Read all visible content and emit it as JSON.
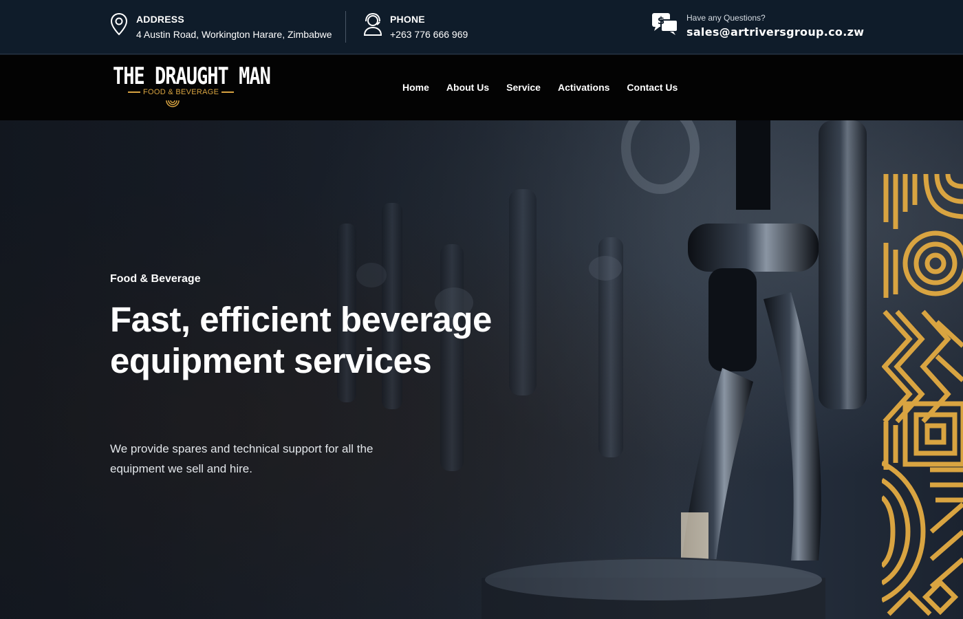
{
  "topbar": {
    "address": {
      "label": "ADDRESS",
      "value": "4 Austin Road, Workington Harare, Zimbabwe",
      "icon": "map-pin-icon"
    },
    "phone": {
      "label": "PHONE",
      "value": "+263 776 666 969",
      "icon": "headset-icon"
    },
    "email": {
      "question": "Have any Questions?",
      "value": "sales@artriversgroup.co.zw",
      "icon": "chat-dollar-icon"
    }
  },
  "logo": {
    "title": "THE DRAUGHT MAN",
    "subtitle": "FOOD & BEVERAGE"
  },
  "nav": {
    "items": [
      "Home",
      "About Us",
      "Service",
      "Activations",
      "Contact Us"
    ]
  },
  "hero": {
    "eyebrow": "Food & Beverage",
    "headline": "Fast, efficient beverage equipment services",
    "description": "We provide spares and technical support for all the equipment we sell and hire."
  },
  "colors": {
    "topbar_bg": "#0f1c2a",
    "nav_bg": "#030303",
    "accent_gold": "#d9a441",
    "text": "#ffffff"
  }
}
